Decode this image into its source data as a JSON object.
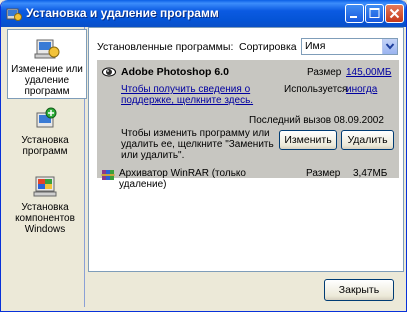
{
  "window": {
    "title": "Установка и удаление программ"
  },
  "sidebar": {
    "items": [
      {
        "label": "Изменение или удаление программ",
        "icon": "change-remove-programs-icon"
      },
      {
        "label": "Установка программ",
        "icon": "add-programs-icon"
      },
      {
        "label": "Установка компонентов Windows",
        "icon": "windows-components-icon"
      }
    ]
  },
  "main": {
    "installed_label": "Установленные программы:",
    "sort_label": "Сортировка",
    "sort_value": "Имя",
    "programs": [
      {
        "name": "Adobe Photoshop 6.0",
        "size_label": "Размер",
        "size_value": "145,00МБ",
        "support_link": "Чтобы получить сведения о поддержке, щелкните здесь.",
        "used_label": "Используется",
        "used_value": "иногда",
        "last_used": "Последний вызов 08.09.2002",
        "change_hint": "Чтобы изменить программу или удалить ее, щелкните \"Заменить или удалить\".",
        "change_button": "Изменить",
        "remove_button": "Удалить"
      },
      {
        "name": "Архиватор WinRAR (только удаление)",
        "size_label": "Размер",
        "size_value": "3,47МБ"
      }
    ]
  },
  "footer": {
    "close_button": "Закрыть"
  },
  "colors": {
    "titlebar": "#0554d6",
    "selected_row": "#c7c6c1",
    "link": "#0000a0"
  }
}
